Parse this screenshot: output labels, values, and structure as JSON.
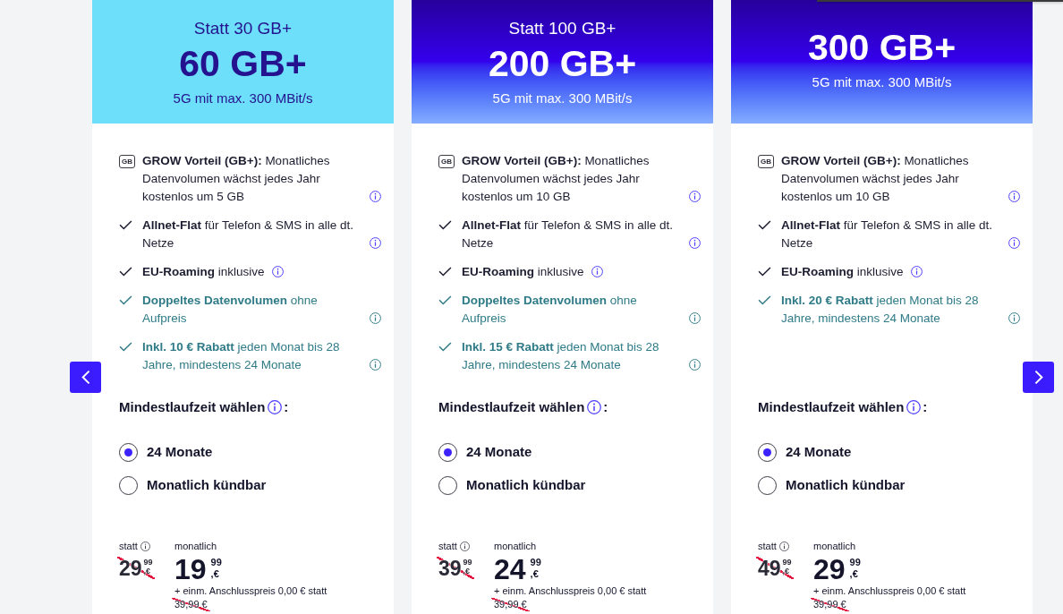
{
  "plans": [
    {
      "kind": "cyan",
      "previous_volume": "Statt 30 GB+",
      "volume": "60 GB+",
      "speed": "5G mit max. 300 MBit/s",
      "features": [
        {
          "kind": "grow",
          "icon_label": "GB",
          "highlight": false,
          "text": "**GROW Vorteil (GB+):** Monatliches Datenvolumen wächst jedes Jahr kostenlos um 5 GB"
        },
        {
          "kind": "check",
          "highlight": false,
          "text": "**Allnet-Flat** für Telefon & SMS in alle dt. Netze"
        },
        {
          "kind": "check",
          "highlight": false,
          "text": "**EU-Roaming** inklusive"
        },
        {
          "kind": "check",
          "highlight": true,
          "text": "**Doppeltes Datenvolumen** ohne Aufpreis"
        },
        {
          "kind": "check",
          "highlight": true,
          "text": "**Inkl. 10 € Rabatt** jeden Monat bis 28 Jahre, mindestens 24 Monate"
        }
      ],
      "term_heading": "Mindestlaufzeit wählen",
      "term_heading_end": ":",
      "terms": [
        {
          "label": "24 Monate",
          "selected": true
        },
        {
          "label": "Monatlich kündbar",
          "selected": false
        }
      ],
      "price": {
        "was_label": "statt",
        "was_euros": "29",
        "was_cents": "99",
        "was_currency": ",€",
        "label": "monatlich",
        "euros": "19",
        "cents": "99",
        "currency": ",€",
        "setup_fee": "+ einm. Anschlusspreis 0,00 € statt",
        "setup_fee_was": "39,99 €"
      }
    },
    {
      "kind": "gradient",
      "previous_volume": "Statt 100 GB+",
      "volume": "200 GB+",
      "speed": "5G mit max. 300 MBit/s",
      "features": [
        {
          "kind": "grow",
          "icon_label": "GB",
          "highlight": false,
          "text": "**GROW Vorteil (GB+):** Monatliches Datenvolumen wächst jedes Jahr kostenlos um 10 GB"
        },
        {
          "kind": "check",
          "highlight": false,
          "text": "**Allnet-Flat** für Telefon & SMS in alle dt. Netze"
        },
        {
          "kind": "check",
          "highlight": false,
          "text": "**EU-Roaming** inklusive"
        },
        {
          "kind": "check",
          "highlight": true,
          "text": "**Doppeltes Datenvolumen** ohne Aufpreis"
        },
        {
          "kind": "check",
          "highlight": true,
          "text": "**Inkl. 15 € Rabatt** jeden Monat bis 28 Jahre, mindestens 24 Monate"
        }
      ],
      "term_heading": "Mindestlaufzeit wählen",
      "term_heading_end": ":",
      "terms": [
        {
          "label": "24 Monate",
          "selected": true
        },
        {
          "label": "Monatlich kündbar",
          "selected": false
        }
      ],
      "price": {
        "was_label": "statt",
        "was_euros": "39",
        "was_cents": "99",
        "was_currency": ",€",
        "label": "monatlich",
        "euros": "24",
        "cents": "99",
        "currency": ",€",
        "setup_fee": "+ einm. Anschlusspreis 0,00 € statt",
        "setup_fee_was": "39,99 €"
      }
    },
    {
      "kind": "gradient",
      "volume": "300 GB+",
      "speed": "5G mit max. 300 MBit/s",
      "features": [
        {
          "kind": "grow",
          "icon_label": "GB",
          "highlight": false,
          "text": "**GROW Vorteil (GB+):** Monatliches Datenvolumen wächst jedes Jahr kostenlos um 10 GB"
        },
        {
          "kind": "check",
          "highlight": false,
          "text": "**Allnet-Flat** für Telefon & SMS in alle dt. Netze"
        },
        {
          "kind": "check",
          "highlight": false,
          "text": "**EU-Roaming** inklusive"
        },
        {
          "kind": "check",
          "highlight": true,
          "text": "**Inkl. 20 € Rabatt** jeden Monat bis 28 Jahre, mindestens 24 Monate"
        }
      ],
      "term_heading": "Mindestlaufzeit wählen",
      "term_heading_end": ":",
      "terms": [
        {
          "label": "24 Monate",
          "selected": true
        },
        {
          "label": "Monatlich kündbar",
          "selected": false
        }
      ],
      "price": {
        "was_label": "statt",
        "was_euros": "49",
        "was_cents": "99",
        "was_currency": ",€",
        "label": "monatlich",
        "euros": "29",
        "cents": "99",
        "currency": ",€",
        "setup_fee": "+ einm. Anschlusspreis 0,00 € statt",
        "setup_fee_was": "39,99 €"
      }
    }
  ]
}
